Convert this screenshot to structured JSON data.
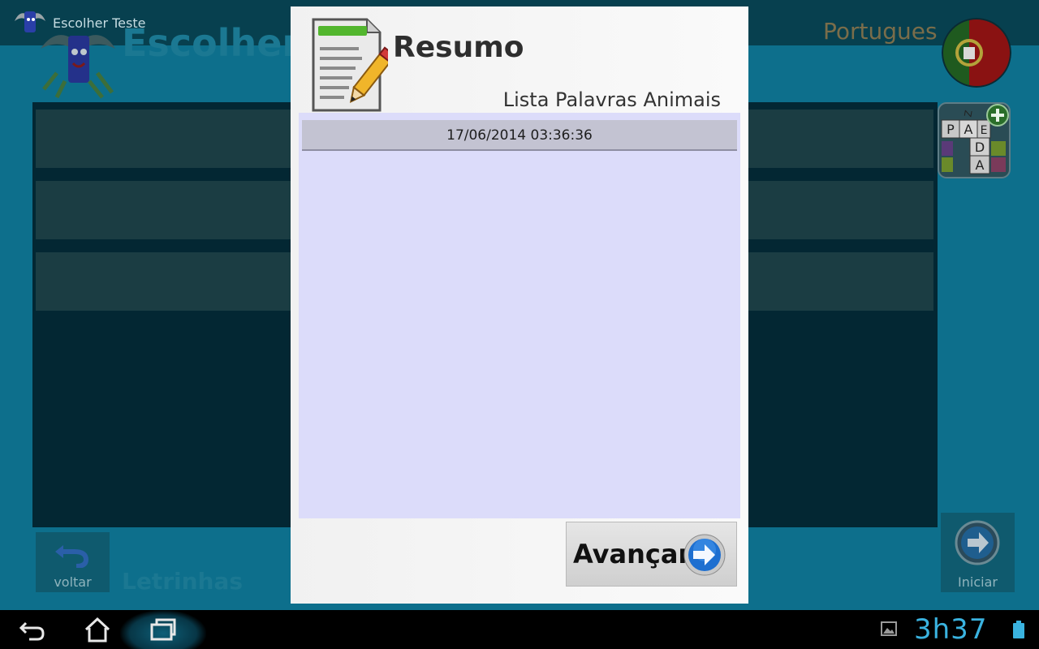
{
  "app": {
    "title_small": "Escolher Teste",
    "title_big": "Escolher T",
    "language": "Portugues",
    "app_name": "Letrinhas",
    "back_label": "voltar",
    "start_label": "Iniciar",
    "tile_letters": [
      "P",
      "A",
      "E",
      "D",
      "A",
      "Z"
    ]
  },
  "dialog": {
    "title": "Resumo",
    "subtitle": "Lista Palavras Animais",
    "results": [
      "17/06/2014 03:36:36"
    ],
    "advance_label": "Avançar"
  },
  "system_bar": {
    "clock": "3h37"
  },
  "colors": {
    "accent": "#3ab3e0",
    "result_area": "#dcdcfa",
    "result_row": "#c3c3d2"
  }
}
